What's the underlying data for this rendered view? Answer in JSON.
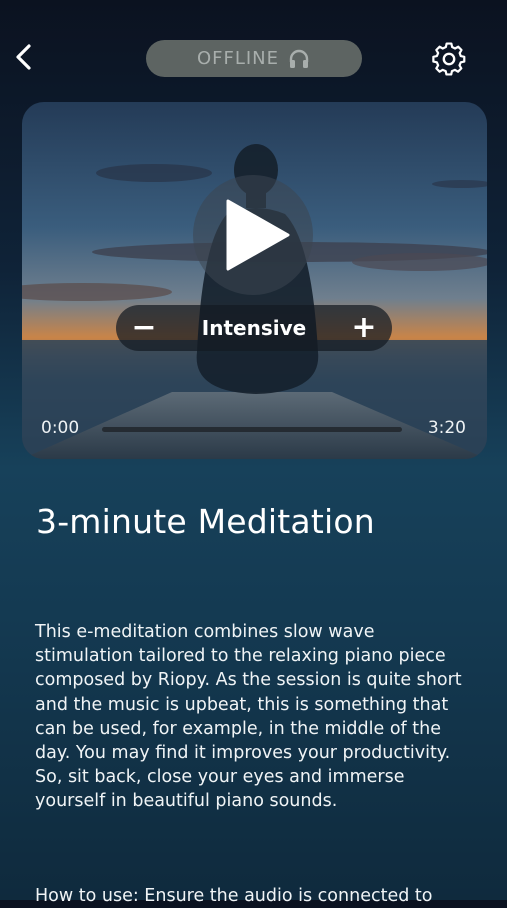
{
  "header": {
    "back_icon": "chevron-left-icon",
    "status_label": "OFFLINE",
    "status_icon": "headphones-icon",
    "settings_icon": "gear-icon"
  },
  "player": {
    "play_icon": "play-icon",
    "intensity_label": "Intensive",
    "decrease_label": "−",
    "increase_label": "+",
    "current_time": "0:00",
    "total_time": "3:20",
    "progress": 0
  },
  "content": {
    "title": "3-minute Meditation",
    "description": "This e-meditation combines slow wave stimulation tailored to the relaxing piano piece composed by Riopy. As the session is quite short and the music is upbeat, this is something that can be used, for example, in the middle of the day. You may find it improves your productivity. So, sit back, close your eyes and immerse yourself in beautiful piano sounds.",
    "how_to_use": "How to use: Ensure the audio is connected to"
  },
  "colors": {
    "pill_bg": "#5d6462",
    "pill_text": "#a8aeac",
    "sky_top": "#2e4a6a",
    "horizon": "#d07a3a"
  }
}
